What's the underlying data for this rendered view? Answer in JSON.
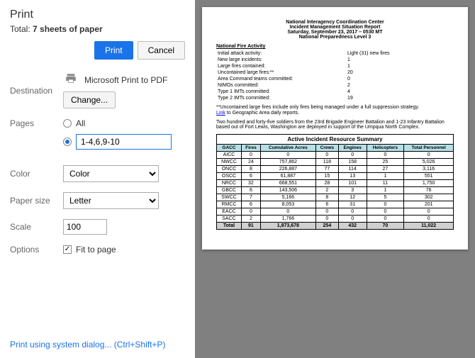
{
  "dialog": {
    "title": "Print",
    "total_prefix": "Total: ",
    "total_value": "7 sheets of paper",
    "print_btn": "Print",
    "cancel_btn": "Cancel"
  },
  "destination": {
    "label": "Destination",
    "name": "Microsoft Print to PDF",
    "change_btn": "Change..."
  },
  "pages": {
    "label": "Pages",
    "all_label": "All",
    "custom_value": "1-4,6,9-10"
  },
  "color": {
    "label": "Color",
    "value": "Color"
  },
  "paper": {
    "label": "Paper size",
    "value": "Letter"
  },
  "scale": {
    "label": "Scale",
    "value": "100"
  },
  "options": {
    "label": "Options",
    "fit_label": "Fit to page"
  },
  "syslink": {
    "text": "Print using system dialog... ",
    "shortcut": "(Ctrl+Shift+P)"
  },
  "doc": {
    "header": [
      "National Interagency Coordination Center",
      "Incident Management Situation Report",
      "Saturday, September 23, 2017 – 0530 MT",
      "National Preparedness Level 3"
    ],
    "fire_section_title": "National Fire Activity",
    "fire_rows": [
      [
        "Initial attack activity:",
        "Light (31) new fires"
      ],
      [
        "New large incidents:",
        "1"
      ],
      [
        "Large fires contained:",
        "1"
      ],
      [
        "Uncontained large fires:**",
        "20"
      ],
      [
        "Area Command teams committed:",
        "0"
      ],
      [
        "NIMOs committed:",
        "2"
      ],
      [
        "Type 1 IMTs committed:",
        "4"
      ],
      [
        "Type 2 IMTs committed:",
        "19"
      ]
    ],
    "note1": "**Uncontained large fires include only fires being managed under a full suppression strategy.",
    "link_word": "Link",
    "link_rest": " to Geographic Area daily reports.",
    "para": "Two hundred and forty-five soldiers from the 23rd Brigade Engineer Battalion and 1-23 Infantry Battalion based out of Fort Lewis, Washington are deployed in support of the Umpqua North Complex.",
    "table_caption": "Active Incident Resource Summary",
    "table_headers": [
      "GACC",
      "Fires",
      "Cumulative Acres",
      "Crews",
      "Engines",
      "Helicopters",
      "Total Personnel"
    ],
    "table_rows": [
      [
        "AICC",
        "0",
        "0",
        "0",
        "0",
        "0",
        "0"
      ],
      [
        "NWCC",
        "24",
        "757,862",
        "118",
        "158",
        "25",
        "5,026"
      ],
      [
        "ONCC",
        "8",
        "226,887",
        "77",
        "114",
        "27",
        "3,116"
      ],
      [
        "OSCC",
        "6",
        "61,887",
        "15",
        "13",
        "1",
        "551"
      ],
      [
        "NRCC",
        "32",
        "668,551",
        "28",
        "101",
        "11",
        "1,750"
      ],
      [
        "GBCC",
        "6",
        "143,506",
        "2",
        "3",
        "1",
        "76"
      ],
      [
        "SWCC",
        "7",
        "5,166",
        "8",
        "12",
        "5",
        "302"
      ],
      [
        "RMCC",
        "6",
        "8,053",
        "6",
        "31",
        "0",
        "201"
      ],
      [
        "EACC",
        "0",
        "0",
        "0",
        "0",
        "0",
        "0"
      ],
      [
        "SACC",
        "2",
        "1,766",
        "0",
        "0",
        "0",
        "0"
      ]
    ],
    "table_total": [
      "Total",
      "91",
      "1,873,678",
      "254",
      "432",
      "70",
      "11,022"
    ]
  }
}
